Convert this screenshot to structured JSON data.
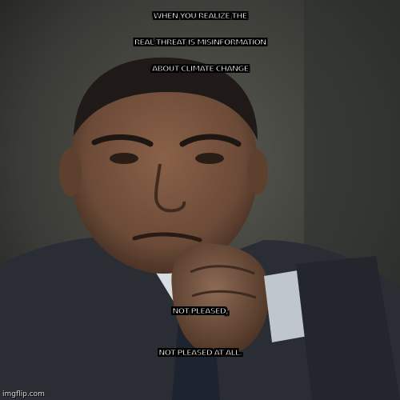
{
  "meme": {
    "top_caption": {
      "line1": "WHEN YOU REALIZE THE",
      "line2": "REAL THREAT IS MISINFORMATION",
      "line3": "ABOUT CLIMATE CHANGE"
    },
    "bottom_caption": {
      "line1": "NOT PLEASED,",
      "line2": "NOT PLEASED AT ALL."
    },
    "watermark": "imgflip.com"
  },
  "colors": {
    "caption_fill": "#ffffff",
    "caption_outline": "#000000",
    "suit": "#2a2d33",
    "skin": "#6b4a37",
    "background": "#3a3a36"
  }
}
